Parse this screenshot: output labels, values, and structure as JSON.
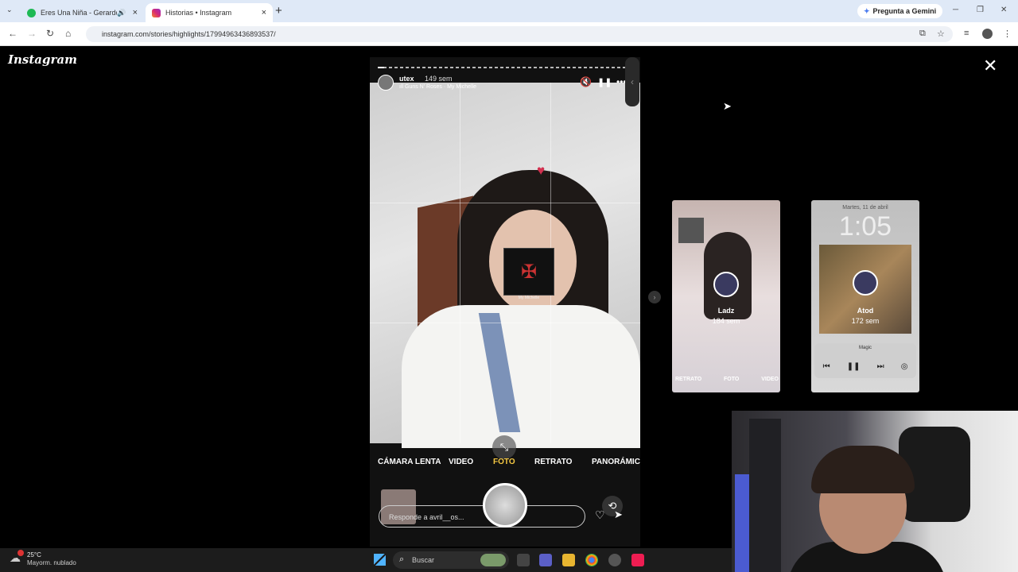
{
  "browser": {
    "tabs": [
      {
        "label": "Eres Una Niña - Gerardo O",
        "active": false,
        "favicon_color": "#1db954"
      },
      {
        "label": "Historias • Instagram",
        "active": true,
        "favicon_color": "#d62976"
      }
    ],
    "new_tab": "+",
    "gemini_label": "Pregunta a Gemini",
    "url": "instagram.com/stories/highlights/17994963436893537/"
  },
  "instagram": {
    "logo": "Instagram",
    "close_icon": "✕"
  },
  "story": {
    "username": "utex",
    "time_ago": "149 sem",
    "music": "Guns N' Roses · My Michelle",
    "sticker_caption": "My Michelle",
    "camera_modes": [
      "CÁMARA LENTA",
      "VIDEO",
      "FOTO",
      "RETRATO",
      "PANORÁMIC"
    ],
    "selected_mode": "FOTO",
    "reply_placeholder": "Responde a avril__os..."
  },
  "previews": [
    {
      "name": "Ladz",
      "time_ago": "184 sem",
      "modes": [
        "RETRATO",
        "FOTO",
        "VIDEO"
      ]
    },
    {
      "name": "Atod",
      "time_ago": "172 sem",
      "date": "Martes, 11 de abril",
      "clock": "1:05",
      "player_title": "Magic"
    }
  ],
  "taskbar": {
    "weather_temp": "25°C",
    "weather_desc": "Mayorm. nublado",
    "search_label": "Buscar"
  },
  "colors": {
    "accent_selected_mode": "#f5c842",
    "instagram": "#d62976"
  }
}
